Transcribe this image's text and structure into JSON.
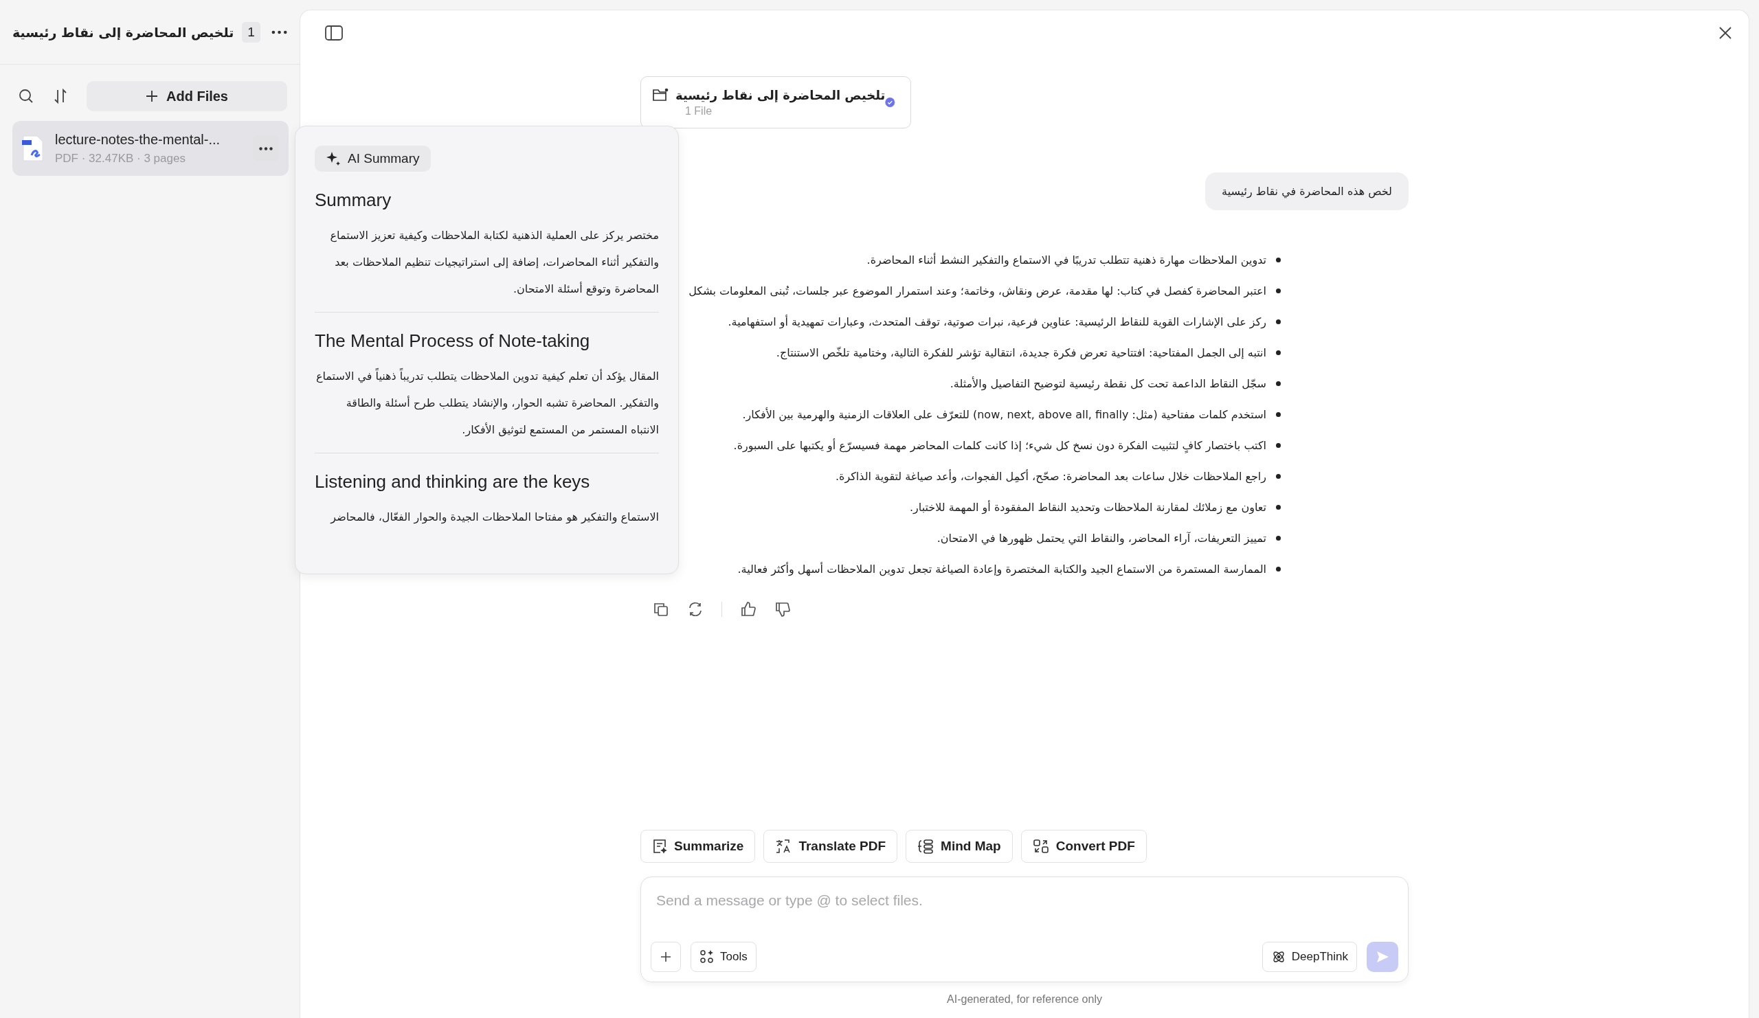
{
  "sidebar": {
    "title": "تلخيص المحاضرة إلى نقاط رئيسية",
    "count": "1",
    "add_files": "Add Files",
    "files": [
      {
        "name": "lecture-notes-the-mental-...",
        "meta": "PDF · 32.47KB · 3 pages",
        "selected": true
      }
    ]
  },
  "ai_summary": {
    "badge": "AI Summary",
    "sections": [
      {
        "heading": "Summary",
        "body": "مختصر يركز على العملية الذهنية لكتابة الملاحظات وكيفية تعزيز الاستماع والتفكير أثناء المحاضرات، إضافة إلى استراتيجيات تنظيم الملاحظات بعد المحاضرة وتوقع أسئلة الامتحان."
      },
      {
        "heading": "The Mental Process of Note-taking",
        "body": "المقال يؤكد أن تعلم كيفية تدوين الملاحظات يتطلب تدريباً ذهنياً في الاستماع والتفكير. المحاضرة تشبه الحوار، والإنشاد يتطلب طرح أسئلة والطاقة الانتباه المستمر من المستمع لتوثيق الأفكار."
      },
      {
        "heading": "Listening and thinking are the keys",
        "body": "الاستماع والتفكير هو مفتاحا الملاحظات الجيدة والحوار الفعّال، فالمحاضر"
      }
    ]
  },
  "folder_card": {
    "title": "تلخيص المحاضرة إلى نقاط رئيسية",
    "subtitle": "1 File",
    "checked": true
  },
  "conversation": {
    "user_message": "لخص هذه المحاضرة في نقاط رئيسية",
    "bullets": [
      "تدوين الملاحظات مهارة ذهنية تتطلب تدريبًا في الاستماع والتفكير النشط أثناء المحاضرة.",
      "اعتبر المحاضرة كفصل في كتاب: لها مقدمة، عرض ونقاش، وخاتمة؛ وعند استمرار الموضوع عبر جلسات، تُبنى المعلومات بشكل",
      "ركز على الإشارات القوية للنقاط الرئيسية: عناوين فرعية، نبرات صوتية، توقف المتحدث، وعبارات تمهيدية أو استفهامية.",
      "انتبه إلى الجمل المفتاحية: افتتاحية تعرض فكرة جديدة، انتقالية تؤشر للفكرة التالية، وختامية تلخّص الاستنتاج.",
      "سجّل النقاط الداعمة تحت كل نقطة رئيسية لتوضيح التفاصيل والأمثلة.",
      "استخدم كلمات مفتاحية (مثل: now, next, above all, finally) للتعرّف على العلاقات الزمنية والهرمية بين الأفكار.",
      "اكتب باختصار كافٍ لتثبيت الفكرة دون نسخ كل شيء؛ إذا كانت كلمات المحاضر مهمة فسيسرّع أو يكتبها على السبورة.",
      "راجع الملاحظات خلال ساعات بعد المحاضرة: صحّح، أكمِل الفجوات، وأعد صياغة لتقوية الذاكرة.",
      "تعاون مع زملائك لمقارنة الملاحظات وتحديد النقاط المفقودة أو المهمة للاختبار.",
      "تمييز التعريفات، آراء المحاضر، والنقاط التي يحتمل ظهورها في الامتحان.",
      "الممارسة المستمرة من الاستماع الجيد والكتابة المختصرة وإعادة الصياغة تجعل تدوين الملاحظات أسهل وأكثر فعالية."
    ]
  },
  "quick_actions": {
    "summarize": "Summarize",
    "translate": "Translate PDF",
    "mindmap": "Mind Map",
    "convert": "Convert PDF"
  },
  "composer": {
    "placeholder": "Send a message or type @ to select files.",
    "tools": "Tools",
    "deepthink": "DeepThink",
    "send_enabled": false
  },
  "footer": "AI-generated, for reference only"
}
